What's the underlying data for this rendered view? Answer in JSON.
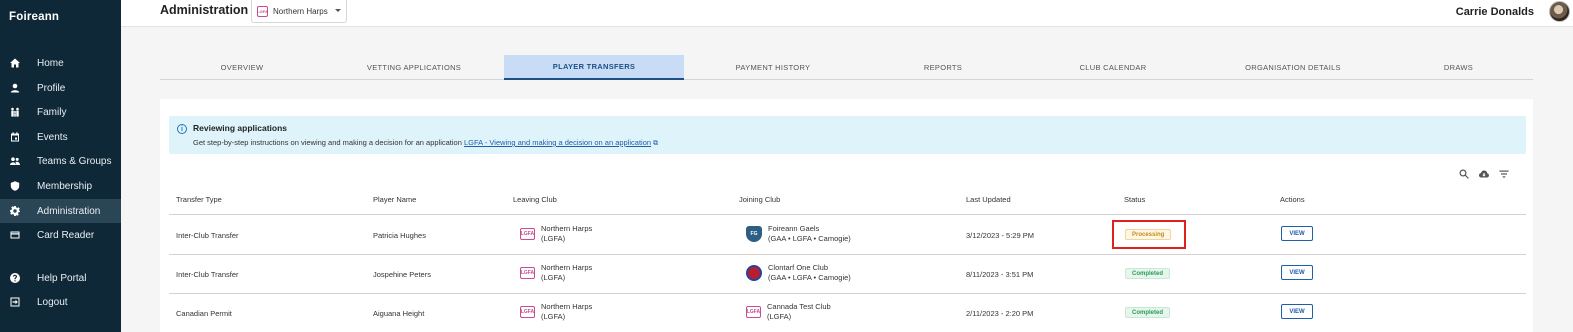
{
  "sidebar": {
    "brand": "Foireann",
    "items": [
      {
        "label": "Home",
        "icon": "home-icon"
      },
      {
        "label": "Profile",
        "icon": "person-icon"
      },
      {
        "label": "Family",
        "icon": "family-icon"
      },
      {
        "label": "Events",
        "icon": "calendar-icon"
      },
      {
        "label": "Teams & Groups",
        "icon": "group-icon"
      },
      {
        "label": "Membership",
        "icon": "shield-icon"
      },
      {
        "label": "Administration",
        "icon": "gear-icon",
        "active": true
      },
      {
        "label": "Card Reader",
        "icon": "card-icon"
      },
      {
        "label": "Help Portal",
        "icon": "help-icon"
      },
      {
        "label": "Logout",
        "icon": "logout-icon"
      }
    ]
  },
  "header": {
    "title": "Administration",
    "org_selected": "Northern Harps",
    "user_name": "Carrie Donalds"
  },
  "tabs": [
    {
      "label": "OVERVIEW"
    },
    {
      "label": "VETTING APPLICATIONS"
    },
    {
      "label": "PLAYER TRANSFERS",
      "active": true
    },
    {
      "label": "PAYMENT HISTORY"
    },
    {
      "label": "REPORTS"
    },
    {
      "label": "CLUB CALENDAR"
    },
    {
      "label": "ORGANISATION DETAILS"
    },
    {
      "label": "DRAWS"
    }
  ],
  "banner": {
    "title": "Reviewing applications",
    "text": "Get step-by-step instructions on viewing and making a decision for an application",
    "link": "LGFA - Viewing and making a decision on an application"
  },
  "toolbar": {
    "icons": [
      "search-icon",
      "cloud-download-icon",
      "filter-icon"
    ]
  },
  "table": {
    "headers": [
      "Transfer Type",
      "Player Name",
      "Leaving Club",
      "Joining Club",
      "Last Updated",
      "Status",
      "Actions"
    ],
    "rows": [
      {
        "type": "Inter-Club Transfer",
        "player": "Patricia Hughes",
        "leaving_name": "Northern Harps",
        "leaving_sub": "(LGFA)",
        "joining_name": "Foireann Gaels",
        "joining_sub": "(GAA • LGFA • Camogie)",
        "updated": "3/12/2023 - 5:29 PM",
        "status": "Processing",
        "action": "VIEW"
      },
      {
        "type": "Inter-Club Transfer",
        "player": "Jospehine Peters",
        "leaving_name": "Northern Harps",
        "leaving_sub": "(LGFA)",
        "joining_name": "Clontarf One Club",
        "joining_sub": "(GAA • LGFA • Camogie)",
        "updated": "8/11/2023 - 3:51 PM",
        "status": "Completed",
        "action": "VIEW"
      },
      {
        "type": "Canadian Permit",
        "player": "Aiguana Height",
        "leaving_name": "Northern Harps",
        "leaving_sub": "(LGFA)",
        "joining_name": "Cannada Test Club",
        "joining_sub": "(LGFA)",
        "updated": "2/11/2023 - 2:20 PM",
        "status": "Completed",
        "action": "VIEW"
      }
    ]
  },
  "colors": {
    "sidebar_bg": "#0f2838",
    "accent": "#1d4f86",
    "banner_bg": "#dff3fb",
    "highlight": "#e02020"
  }
}
